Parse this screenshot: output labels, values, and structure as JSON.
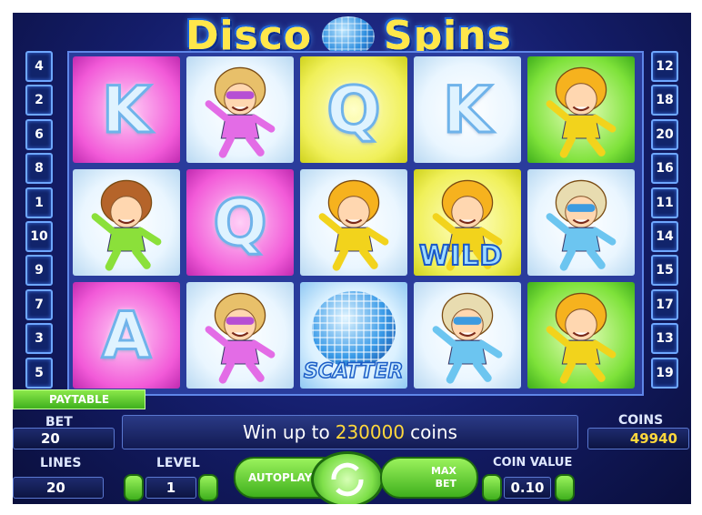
{
  "title": {
    "left": "Disco",
    "right": "Spins"
  },
  "left_lines": [
    "4",
    "2",
    "6",
    "8",
    "1",
    "10",
    "9",
    "7",
    "3",
    "5"
  ],
  "right_lines": [
    "12",
    "18",
    "20",
    "16",
    "11",
    "14",
    "15",
    "17",
    "13",
    "19"
  ],
  "reels": [
    [
      {
        "kind": "letter",
        "text": "K",
        "bg": "pink"
      },
      {
        "kind": "char",
        "icon": "dancer-green-girl-icon",
        "bg": "white"
      },
      {
        "kind": "letter",
        "text": "A",
        "bg": "pink"
      }
    ],
    [
      {
        "kind": "char",
        "icon": "dancer-purple-lady-icon",
        "bg": "white"
      },
      {
        "kind": "letter",
        "text": "Q",
        "bg": "pink"
      },
      {
        "kind": "char",
        "icon": "dancer-purple-lady-icon",
        "bg": "white"
      }
    ],
    [
      {
        "kind": "letter",
        "text": "Q",
        "bg": "yellow"
      },
      {
        "kind": "char",
        "icon": "dancer-yellow-man-icon",
        "bg": "white"
      },
      {
        "kind": "scatter",
        "text": "SCATTER",
        "bg": "sky"
      }
    ],
    [
      {
        "kind": "letter",
        "text": "K",
        "bg": "white"
      },
      {
        "kind": "wild",
        "text": "WILD",
        "bg": "yellow"
      },
      {
        "kind": "char",
        "icon": "dancer-blue-man-icon",
        "bg": "white"
      }
    ],
    [
      {
        "kind": "char",
        "icon": "dancer-yellow-man-icon",
        "bg": "green"
      },
      {
        "kind": "char",
        "icon": "dancer-blue-man-icon",
        "bg": "white"
      },
      {
        "kind": "char",
        "icon": "dancer-yellow-man-icon",
        "bg": "green"
      }
    ]
  ],
  "paytable_label": "PAYTABLE",
  "bet": {
    "label": "BET",
    "value": "20"
  },
  "lines": {
    "label": "LINES",
    "value": "20"
  },
  "level": {
    "label": "LEVEL",
    "value": "1"
  },
  "coin_value": {
    "label": "COIN VALUE",
    "value": "0.10"
  },
  "coins": {
    "label": "COINS",
    "value": "49940"
  },
  "message": {
    "prefix": "Win up to",
    "amount": "230000",
    "suffix": "coins"
  },
  "buttons": {
    "autoplay": "AUTOPLAY",
    "max_bet_1": "MAX",
    "max_bet_2": "BET"
  },
  "colors": {
    "accent": "#3fb01d",
    "gold": "#ffd83c",
    "panel": "#141d6a"
  }
}
